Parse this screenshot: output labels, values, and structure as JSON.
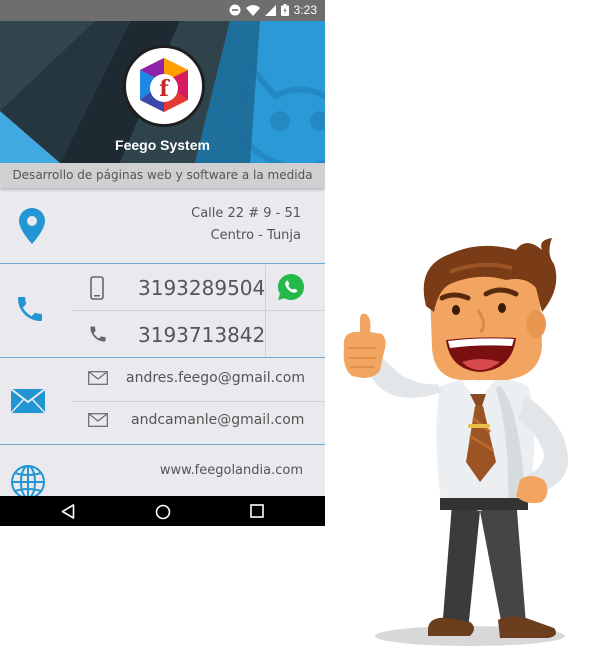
{
  "status_bar": {
    "time": "3:23"
  },
  "header": {
    "company_name": "Feego System",
    "logo_letter": "f"
  },
  "tagline": "Desarrollo de páginas web y software a la medida",
  "address": {
    "line1": "Calle 22 # 9 - 51",
    "line2": "Centro - Tunja"
  },
  "phones": {
    "mobile": "3193289504",
    "landline": "3193713842"
  },
  "emails": {
    "primary": "andres.feego@gmail.com",
    "secondary": "andcamanle@gmail.com"
  },
  "website": "www.feegolandia.com",
  "colors": {
    "accent_blue": "#2196d3",
    "whatsapp_green": "#25b84a",
    "header_blue": "#2a99d6"
  },
  "icons": [
    "location-pin-icon",
    "phone-icon",
    "mobile-phone-icon",
    "landline-phone-icon",
    "whatsapp-icon",
    "mail-icon",
    "envelope-outline-icon",
    "globe-icon",
    "back-icon",
    "home-icon",
    "recents-icon"
  ]
}
